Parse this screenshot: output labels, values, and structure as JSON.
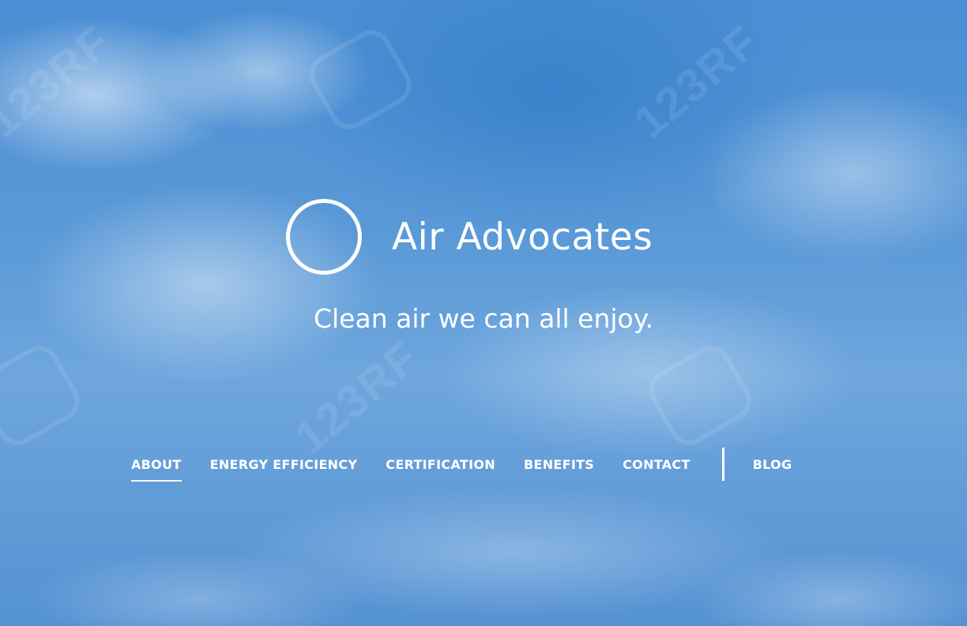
{
  "site": {
    "name": "Air Advocates",
    "tagline": "Clean air we can all enjoy."
  },
  "nav": {
    "items": [
      {
        "label": "ABOUT",
        "active": true
      },
      {
        "label": "ENERGY EFFICIENCY",
        "active": false
      },
      {
        "label": "CERTIFICATION",
        "active": false
      },
      {
        "label": "BENEFITS",
        "active": false
      },
      {
        "label": "CONTACT",
        "active": false
      }
    ],
    "secondary": {
      "label": "BLOG"
    }
  },
  "watermark": {
    "text": "123RF"
  },
  "colors": {
    "text": "#ffffff",
    "sky": "#4a8ed4"
  },
  "icons": {
    "logo": "circle-ring-icon"
  }
}
